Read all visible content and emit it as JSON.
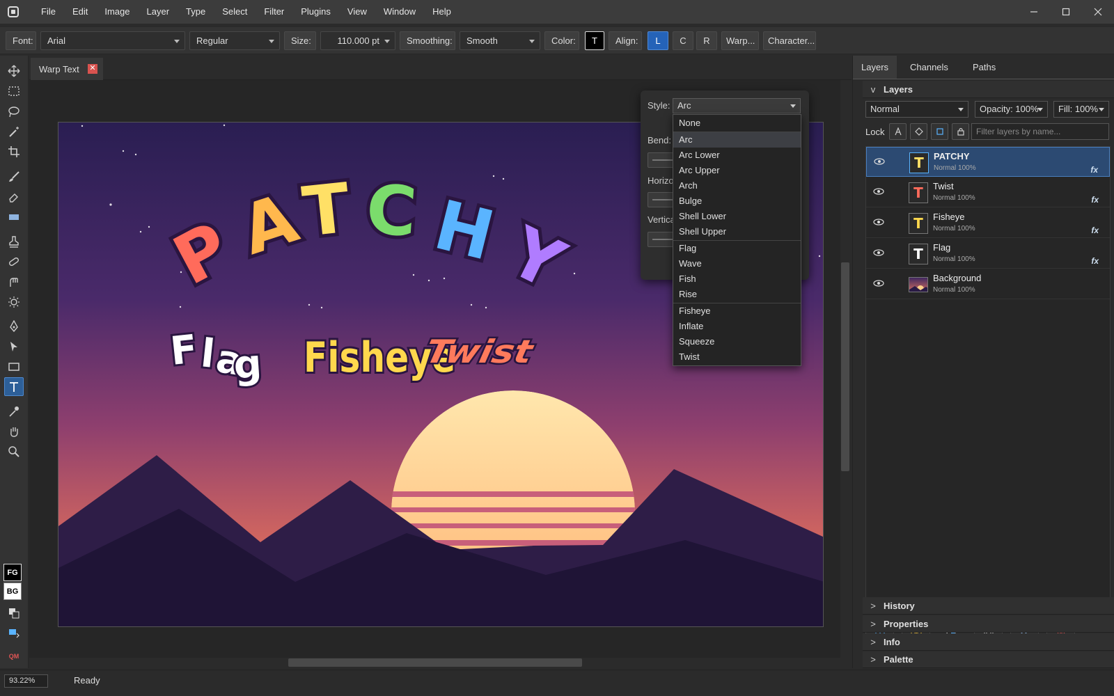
{
  "menubar": {
    "items": [
      "File",
      "Edit",
      "Image",
      "Layer",
      "Type",
      "Select",
      "Filter",
      "Plugins",
      "View",
      "Window",
      "Help"
    ]
  },
  "window_controls": [
    "minimize-icon",
    "maximize-icon",
    "close-icon"
  ],
  "options": {
    "font_label": "Font:",
    "font_value": "Arial",
    "style_value": "Regular",
    "size_label": "Size:",
    "size_value": "110.000 pt",
    "smoothing_label": "Smoothing:",
    "smoothing_value": "Smooth",
    "color_label": "Color:",
    "color_swatch": "T",
    "align_label": "Align:",
    "align_left": "L",
    "align_center": "C",
    "align_right": "R",
    "warp_button": "Warp...",
    "character_button": "Character..."
  },
  "tools": [
    "move-icon",
    "marquee-icon",
    "lasso-icon",
    "magic-wand-icon",
    "crop-icon",
    "brush-icon",
    "eraser-icon",
    "gradient-icon",
    "stamp-icon",
    "heal-icon",
    "smudge-icon",
    "dodge-icon",
    "pen-icon",
    "path-select-icon",
    "rectangle-icon",
    "text-icon",
    "eyedropper-icon",
    "hand-icon",
    "zoom-icon"
  ],
  "colors": {
    "fg_label": "FG",
    "bg_label": "BG",
    "quickmask_label": "QM",
    "accent": "#2d5f98"
  },
  "document": {
    "tab_title": "Warp Text",
    "close_glyph": "✕"
  },
  "canvas_text": {
    "main": [
      "P",
      "A",
      "T",
      "C",
      "H",
      "Y"
    ],
    "main_colors": [
      "#ff6b5b",
      "#ffb84d",
      "#ffe066",
      "#7bdc6c",
      "#5ab4ff",
      "#b07cff"
    ],
    "flag": [
      "F",
      "l",
      "a",
      "g"
    ],
    "fisheye": "Fisheye",
    "twist": "Twist"
  },
  "warp_dialog": {
    "style_label": "Style:",
    "style_value": "Arc",
    "bend_label": "Bend:",
    "horizontal_label": "Horizo",
    "vertical_label": "Vertica"
  },
  "style_dropdown": {
    "options": [
      "None",
      "Arc",
      "Arc Lower",
      "Arc Upper",
      "Arch",
      "Bulge",
      "Shell Lower",
      "Shell Upper",
      "Flag",
      "Wave",
      "Fish",
      "Rise",
      "Fisheye",
      "Inflate",
      "Squeeze",
      "Twist"
    ],
    "selected": "Arc"
  },
  "panel": {
    "tabs": [
      "Layers",
      "Channels",
      "Paths"
    ],
    "layers_header": "Layers",
    "collapse_glyph": "v",
    "blend_mode": "Normal",
    "opacity": "Opacity: 100%",
    "fill": "Fill: 100%",
    "lock_label": "Lock",
    "filter_placeholder": "Filter layers by name...",
    "layers": [
      {
        "name": "PATCHY",
        "mode": "Normal  100%",
        "fx": "fx",
        "thumb": "T",
        "thumb_color": "#ffe066"
      },
      {
        "name": "Twist",
        "mode": "Normal  100%",
        "fx": "fx",
        "thumb": "T",
        "thumb_color": "#ff6b5b"
      },
      {
        "name": "Fisheye",
        "mode": "Normal  100%",
        "fx": "fx",
        "thumb": "T",
        "thumb_color": "#ffd84d"
      },
      {
        "name": "Flag",
        "mode": "Normal  100%",
        "fx": "fx",
        "thumb": "T",
        "thumb_color": "#ffffff"
      },
      {
        "name": "Background",
        "mode": "Normal  100%",
        "fx": "",
        "thumb": "",
        "thumb_color": ""
      }
    ],
    "sections": [
      "History",
      "Properties",
      "Info",
      "Palette"
    ],
    "expand_glyph": ">"
  },
  "status": {
    "zoom": "93.22%",
    "text": "Ready"
  }
}
